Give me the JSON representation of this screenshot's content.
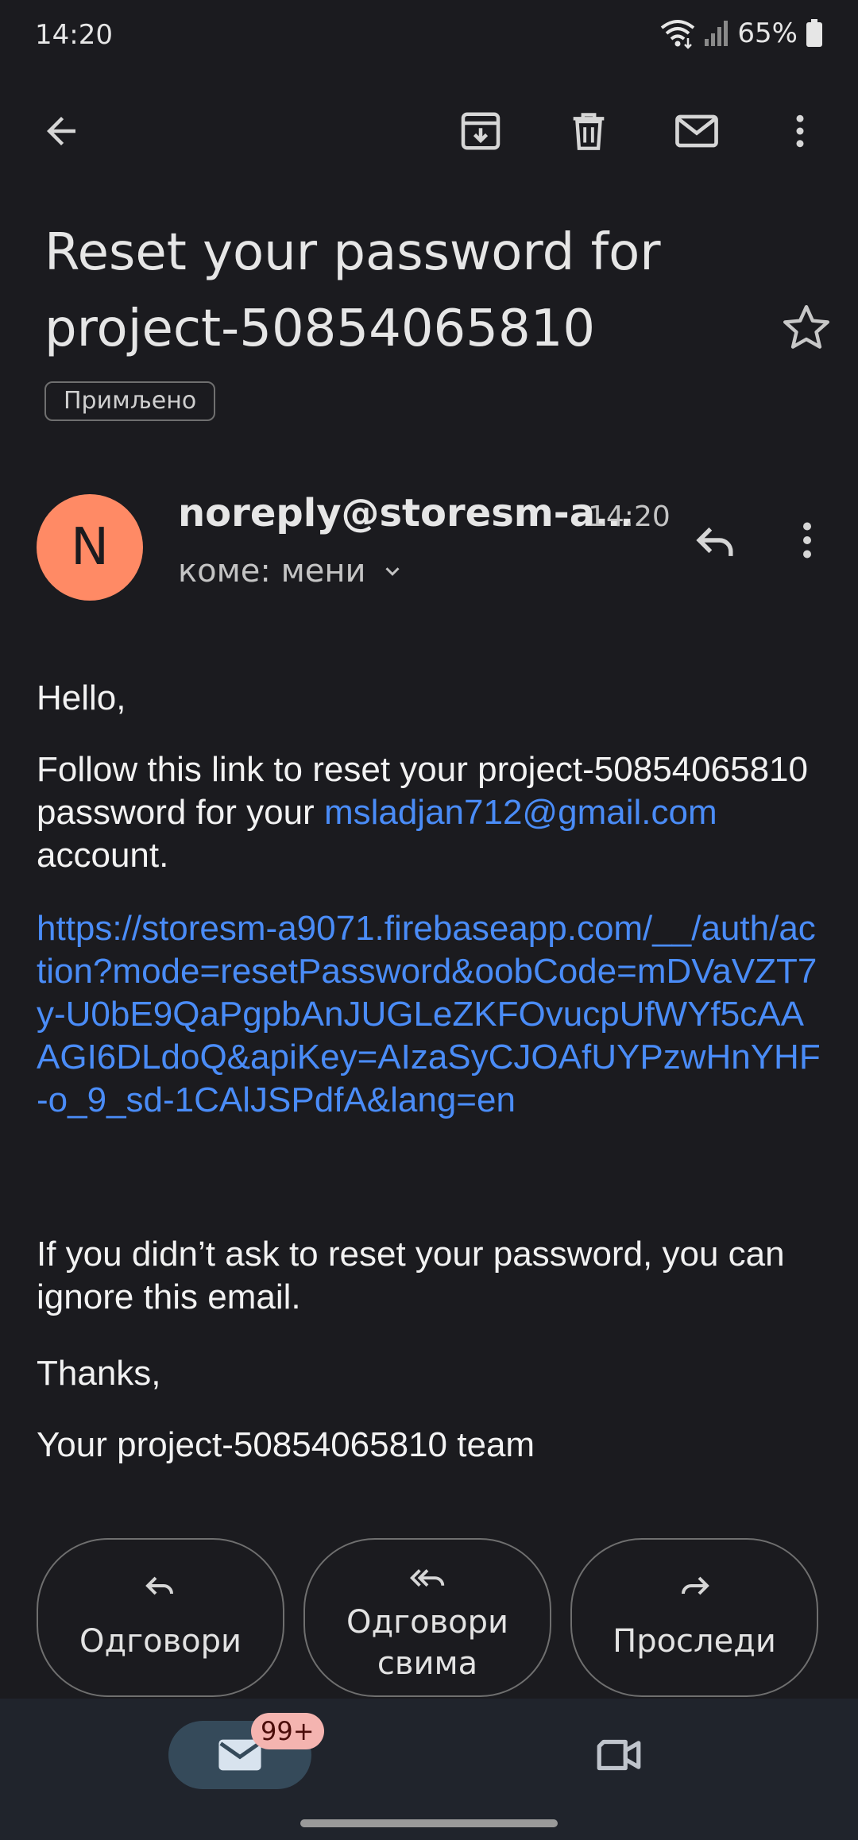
{
  "status_bar": {
    "time": "14:20",
    "battery": "65%",
    "icons": [
      "wifi-icon",
      "signal-icon",
      "battery-icon"
    ]
  },
  "toolbar": {
    "icons": [
      "back-icon",
      "archive-icon",
      "delete-icon",
      "mark-unread-icon",
      "more-vert-icon"
    ]
  },
  "email": {
    "subject": "Reset your password for project-50854065810",
    "label": "Примљено",
    "sender": {
      "initial": "N",
      "avatar_color": "#ff8a65",
      "name": "noreply@storesm-a…",
      "time": "14:20",
      "recipient": "коме: мени"
    },
    "body": {
      "greeting": "Hello,",
      "line1_prefix": "Follow this link to reset your project-50854065810 password for your",
      "email_link": "msladjan712@gmail.com",
      "line1_suffix": "account.",
      "reset_url": "https://storesm-a9071.firebaseapp.com/__/auth/action?mode=resetPassword&oobCode=mDVaVZT7y-U0bE9QaPgpbAnJUGLeZKFOvucpUfWYf5cAAAGI6DLdoQ&apiKey=AIzaSyCJOAfUYPzwHnYHF-o_9_sd-1CAlJSPdfA&lang=en",
      "ignore": "If you didn’t ask to reset your password, you can ignore this email.",
      "thanks": "Thanks,",
      "signature": "Your project-50854065810 team"
    }
  },
  "actions": {
    "reply": "Одговори",
    "reply_all_line1": "Одговори",
    "reply_all_line2": "свима",
    "forward": "Проследи"
  },
  "bottom_nav": {
    "mail_badge": "99+",
    "icons": [
      "mail-icon",
      "video-icon"
    ]
  },
  "colors": {
    "background": "#1b1b1f",
    "link": "#4a8cf7",
    "badge": "#f4b4b0",
    "nav": "#20242c"
  }
}
